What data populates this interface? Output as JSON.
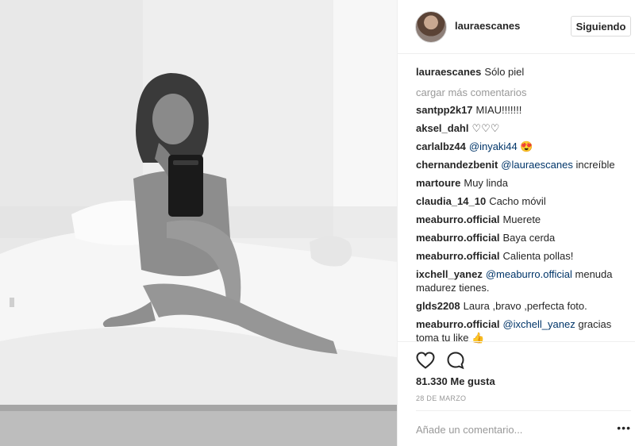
{
  "post": {
    "username": "lauraescanes",
    "follow_label": "Siguiendo",
    "caption_user": "lauraescanes",
    "caption_text": "Sólo piel",
    "load_more": "cargar más comentarios",
    "comments": [
      {
        "user": "santpp2k17",
        "mention": "",
        "text": "MIAU!!!!!!!"
      },
      {
        "user": "aksel_dahl",
        "mention": "",
        "text": "♡♡♡"
      },
      {
        "user": "carlalbz44",
        "mention": "@inyaki44",
        "text": "😍"
      },
      {
        "user": "chernandezbenit",
        "mention": "@lauraescanes",
        "text": "increíble"
      },
      {
        "user": "martoure",
        "mention": "",
        "text": "Muy linda"
      },
      {
        "user": "claudia_14_10",
        "mention": "",
        "text": "Cacho móvil"
      },
      {
        "user": "meaburro.official",
        "mention": "",
        "text": "Muerete"
      },
      {
        "user": "meaburro.official",
        "mention": "",
        "text": "Baya cerda"
      },
      {
        "user": "meaburro.official",
        "mention": "",
        "text": "Calienta pollas!"
      },
      {
        "user": "ixchell_yanez",
        "mention": "@meaburro.official",
        "text": "menuda madurez tienes."
      },
      {
        "user": "glds2208",
        "mention": "",
        "text": "Laura ,bravo ,perfecta foto."
      },
      {
        "user": "meaburro.official",
        "mention": "@ixchell_yanez",
        "text": "gracias toma tu like 👍"
      }
    ],
    "likes": "81.330 Me gusta",
    "date": "28 DE MARZO",
    "comment_placeholder": "Añade un comentario...",
    "more_icon": "more-dots-icon",
    "like_icon": "heart-icon",
    "comment_icon": "speech-bubble-icon"
  }
}
